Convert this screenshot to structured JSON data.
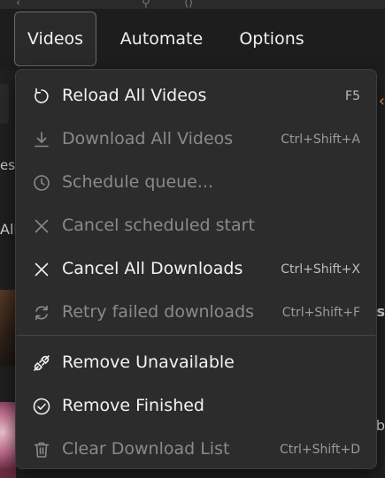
{
  "menubar": {
    "videos": "Videos",
    "automate": "Automate",
    "options": "Options"
  },
  "background": {
    "left_text_1": "est",
    "left_text_2": "All",
    "right_text_1": "s",
    "right_text_2": "rb"
  },
  "menu": {
    "items": [
      {
        "label": "Reload All Videos",
        "shortcut": "F5",
        "icon": "reload-icon",
        "enabled": true
      },
      {
        "label": "Download All Videos",
        "shortcut": "Ctrl+Shift+A",
        "icon": "download-icon",
        "enabled": false
      },
      {
        "label": "Schedule queue...",
        "shortcut": "",
        "icon": "clock-icon",
        "enabled": false
      },
      {
        "label": "Cancel scheduled start",
        "shortcut": "",
        "icon": "close-icon",
        "enabled": false
      },
      {
        "label": "Cancel All Downloads",
        "shortcut": "Ctrl+Shift+X",
        "icon": "close-icon",
        "enabled": true
      },
      {
        "label": "Retry failed downloads",
        "shortcut": "Ctrl+Shift+F",
        "icon": "retry-icon",
        "enabled": false
      },
      {
        "label": "Remove Unavailable",
        "shortcut": "",
        "icon": "unplug-icon",
        "enabled": true
      },
      {
        "label": "Remove Finished",
        "shortcut": "",
        "icon": "check-circle-icon",
        "enabled": true
      },
      {
        "label": "Clear Download List",
        "shortcut": "Ctrl+Shift+D",
        "icon": "trash-icon",
        "enabled": false
      }
    ]
  },
  "colors": {
    "menu_bg": "#2c2c2c",
    "text": "#f2f2f2",
    "disabled_text": "#8a8a8a",
    "accent": "#e8a060"
  }
}
